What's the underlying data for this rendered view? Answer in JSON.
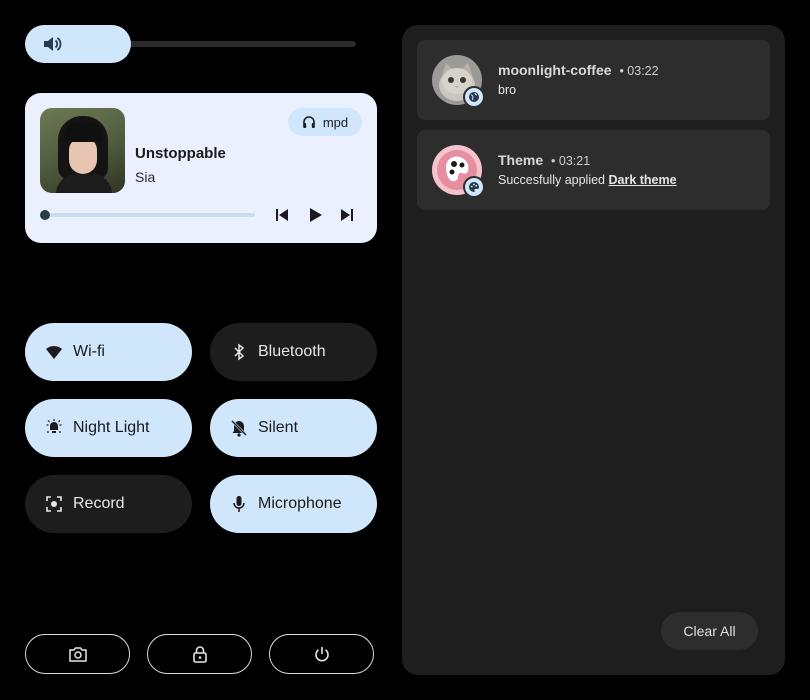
{
  "volume": {
    "level": 0.32
  },
  "media": {
    "player": "mpd",
    "title": "Unstoppable",
    "artist": "Sia",
    "progress": 0.0
  },
  "toggles": [
    {
      "label": "Wi-fi",
      "icon": "wifi-icon",
      "active": true
    },
    {
      "label": "Bluetooth",
      "icon": "bluetooth-icon",
      "active": false
    },
    {
      "label": "Night Light",
      "icon": "night-light-icon",
      "active": true
    },
    {
      "label": "Silent",
      "icon": "bell-off-icon",
      "active": true
    },
    {
      "label": "Record",
      "icon": "record-icon",
      "active": false
    },
    {
      "label": "Microphone",
      "icon": "microphone-icon",
      "active": true
    }
  ],
  "actions": [
    {
      "icon": "screenshot-icon"
    },
    {
      "icon": "lock-icon"
    },
    {
      "icon": "power-icon"
    }
  ],
  "notifications": [
    {
      "app": "moonlight-coffee",
      "time": "03:22",
      "body": "bro",
      "badge_icon": "globe-icon"
    },
    {
      "app": "Theme",
      "time": "03:21",
      "body_prefix": "Succesfully applied ",
      "body_bold": "Dark theme",
      "badge_icon": "palette-icon"
    }
  ],
  "clear_all_label": "Clear All",
  "colors": {
    "accent": "#cfe6fb",
    "card": "#eaf0fe",
    "panel": "#1e1e1e",
    "tile_off": "#1d1d1d"
  }
}
